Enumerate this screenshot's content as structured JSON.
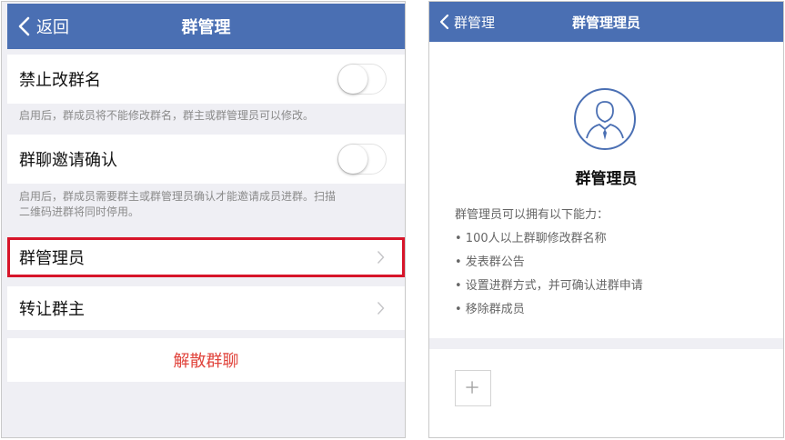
{
  "left": {
    "navbar": {
      "back_label": "返回",
      "title": "群管理"
    },
    "rows": {
      "forbid_rename": {
        "label": "禁止改群名",
        "hint": "启用后，群成员将不能修改群名，群主或群管理员可以修改。",
        "enabled": false
      },
      "invite_confirm": {
        "label": "群聊邀请确认",
        "hint_line1": "启用后，群成员需要群主或群管理员确认才能邀请成员进群。扫描",
        "hint_line2": "二维码进群将同时停用。",
        "enabled": false
      },
      "admins": {
        "label": "群管理员"
      },
      "transfer": {
        "label": "转让群主"
      },
      "dissolve": {
        "label": "解散群聊"
      }
    }
  },
  "right": {
    "navbar": {
      "back_label": "群管理",
      "title": "群管理理员"
    },
    "section_title": "群管理员",
    "capabilities_intro": "群管理员可以拥有以下能力：",
    "capabilities": [
      "• 100人以上群聊修改群名称",
      "• 发表群公告",
      "• 设置进群方式，并可确认进群申请",
      "• 移除群成员"
    ],
    "add_icon": "plus-icon"
  },
  "colors": {
    "navbar": "#4a6fb3",
    "highlight": "#d7152a",
    "danger": "#e0433b",
    "group_bg": "#efeff4"
  }
}
